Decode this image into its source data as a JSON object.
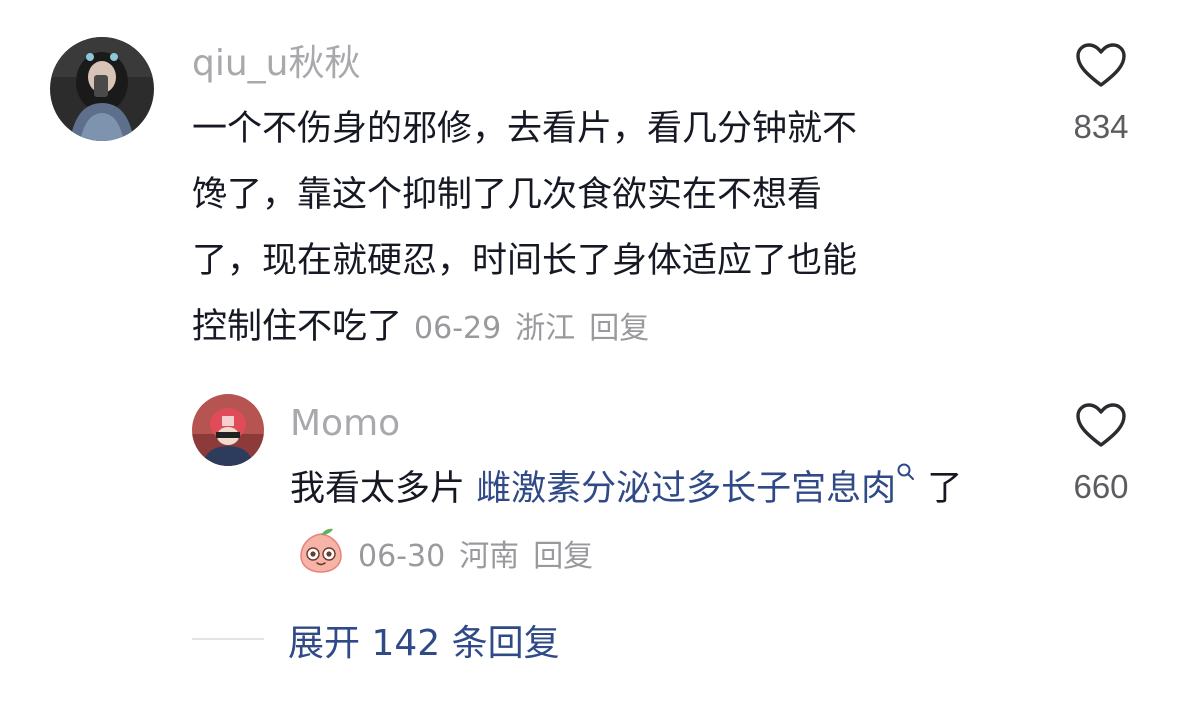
{
  "comment": {
    "username": "qiu_u秋秋",
    "lines": [
      "一个不伤身的邪修，去看片，看几分钟就不",
      "馋了，靠这个抑制了几次食欲实在不想看",
      "了，现在就硬忍，时间长了身体适应了也能",
      "控制住不吃了"
    ],
    "date": "06-29",
    "location": "浙江",
    "reply_label": "回复",
    "likes": "834"
  },
  "reply": {
    "username": "Momo",
    "text_prefix": "我看太多片 ",
    "link_text": "雌激素分泌过多长子宫息肉",
    "text_suffix": " 了",
    "emoji_icon": "peach-face-emoji-icon",
    "date": "06-30",
    "location": "河南",
    "reply_label": "回复",
    "likes": "660"
  },
  "expand": {
    "label": "展开 142 条回复"
  },
  "colors": {
    "username": "#a9a9ad",
    "text": "#161823",
    "meta": "#9a9a9e",
    "link": "#2f4a86"
  }
}
